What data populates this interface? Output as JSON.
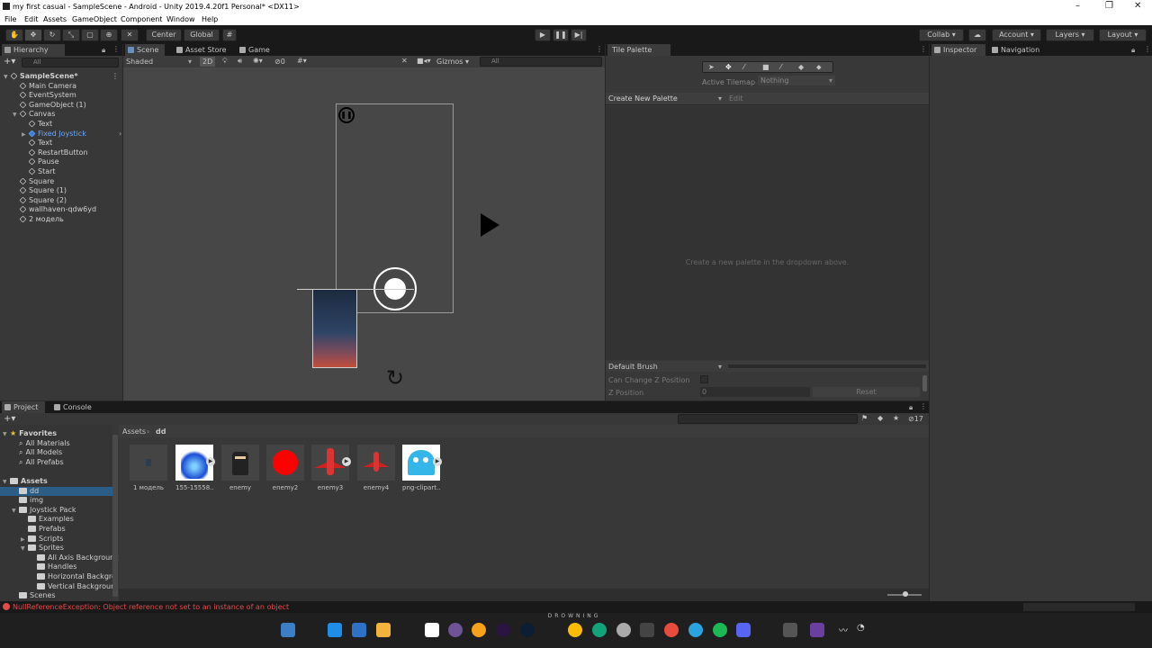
{
  "window": {
    "title": "my first casual - SampleScene - Android - Unity 2019.4.20f1 Personal* <DX11>",
    "controls": [
      "–",
      "❐",
      "✕"
    ]
  },
  "menu": [
    "File",
    "Edit",
    "Assets",
    "GameObject",
    "Component",
    "Window",
    "Help"
  ],
  "toolbar": {
    "center_label": "Center",
    "global_label": "Global",
    "collab_label": "Collab ▾",
    "account_label": "Account",
    "layers_label": "Layers",
    "layout_label": "Layout"
  },
  "hierarchy": {
    "tab": "Hierarchy",
    "search_placeholder": "All",
    "items": [
      {
        "label": "SampleScene*",
        "depth": 0,
        "kind": "scene"
      },
      {
        "label": "Main Camera",
        "depth": 1,
        "kind": "obj"
      },
      {
        "label": "EventSystem",
        "depth": 1,
        "kind": "obj"
      },
      {
        "label": "GameObject (1)",
        "depth": 1,
        "kind": "obj"
      },
      {
        "label": "Canvas",
        "depth": 1,
        "kind": "obj",
        "expanded": true
      },
      {
        "label": "Text",
        "depth": 2,
        "kind": "obj"
      },
      {
        "label": "Fixed Joystick",
        "depth": 2,
        "kind": "prefab"
      },
      {
        "label": "Text",
        "depth": 2,
        "kind": "obj"
      },
      {
        "label": "RestartButton",
        "depth": 2,
        "kind": "obj"
      },
      {
        "label": "Pause",
        "depth": 2,
        "kind": "obj"
      },
      {
        "label": "Start",
        "depth": 2,
        "kind": "obj"
      },
      {
        "label": "Square",
        "depth": 1,
        "kind": "obj"
      },
      {
        "label": "Square (1)",
        "depth": 1,
        "kind": "obj"
      },
      {
        "label": "Square (2)",
        "depth": 1,
        "kind": "obj"
      },
      {
        "label": "wallhaven-qdw6yd",
        "depth": 1,
        "kind": "obj"
      },
      {
        "label": "2 модель",
        "depth": 1,
        "kind": "obj"
      }
    ]
  },
  "scene": {
    "tabs": [
      "Scene",
      "Asset Store",
      "Game"
    ],
    "shading": "Shaded",
    "mode_2d": "2D",
    "fx_count": "0",
    "gizmos": "Gizmos",
    "search_placeholder": "All"
  },
  "tile_palette": {
    "tab": "Tile Palette",
    "active_tilemap_label": "Active Tilemap",
    "active_tilemap_value": "Nothing",
    "palette_dropdown": "Create New Palette",
    "edit_label": "Edit",
    "empty_message": "Create a new palette in the dropdown above.",
    "brush": "Default Brush",
    "can_change_z": "Can Change Z Position",
    "z_position_label": "Z Position",
    "z_position_value": "0",
    "reset_label": "Reset"
  },
  "inspector": {
    "tabs": [
      "Inspector",
      "Navigation"
    ]
  },
  "project": {
    "tabs": [
      "Project",
      "Console"
    ],
    "hidden_count": "17",
    "breadcrumb": [
      "Assets",
      "dd"
    ],
    "tree": [
      {
        "label": "Favorites",
        "depth": 0,
        "kind": "fav"
      },
      {
        "label": "All Materials",
        "depth": 1,
        "kind": "search"
      },
      {
        "label": "All Models",
        "depth": 1,
        "kind": "search"
      },
      {
        "label": "All Prefabs",
        "depth": 1,
        "kind": "search"
      },
      {
        "label": "",
        "depth": 0,
        "kind": "gap"
      },
      {
        "label": "Assets",
        "depth": 0,
        "kind": "folder"
      },
      {
        "label": "dd",
        "depth": 1,
        "kind": "folder",
        "selected": true
      },
      {
        "label": "img",
        "depth": 1,
        "kind": "folder"
      },
      {
        "label": "Joystick Pack",
        "depth": 1,
        "kind": "folder"
      },
      {
        "label": "Examples",
        "depth": 2,
        "kind": "folder"
      },
      {
        "label": "Prefabs",
        "depth": 2,
        "kind": "folder"
      },
      {
        "label": "Scripts",
        "depth": 2,
        "kind": "folder"
      },
      {
        "label": "Sprites",
        "depth": 2,
        "kind": "folder"
      },
      {
        "label": "All Axis Backgrounc",
        "depth": 3,
        "kind": "folder"
      },
      {
        "label": "Handles",
        "depth": 3,
        "kind": "folder"
      },
      {
        "label": "Horizontal Backgro",
        "depth": 3,
        "kind": "folder"
      },
      {
        "label": "Vertical Backgroun",
        "depth": 3,
        "kind": "folder"
      },
      {
        "label": "Scenes",
        "depth": 1,
        "kind": "folder"
      }
    ],
    "assets": [
      {
        "label": "1 модель",
        "thumb": "model"
      },
      {
        "label": "155-15558...",
        "thumb": "blue-flame"
      },
      {
        "label": "enemy",
        "thumb": "ninja"
      },
      {
        "label": "enemy2",
        "thumb": "red-circle"
      },
      {
        "label": "enemy3",
        "thumb": "red-ship"
      },
      {
        "label": "enemy4",
        "thumb": "red-ship-small"
      },
      {
        "label": "png-clipart...",
        "thumb": "ghost"
      }
    ]
  },
  "status": {
    "error": "NullReferenceException: Object reference not set to an instance of an object"
  },
  "taskbar": {
    "center_text": "DROWNING"
  },
  "colors": {
    "accent_blue": "#3c7fd9",
    "error_red": "#e34a4a",
    "selection": "#2c5d87"
  }
}
